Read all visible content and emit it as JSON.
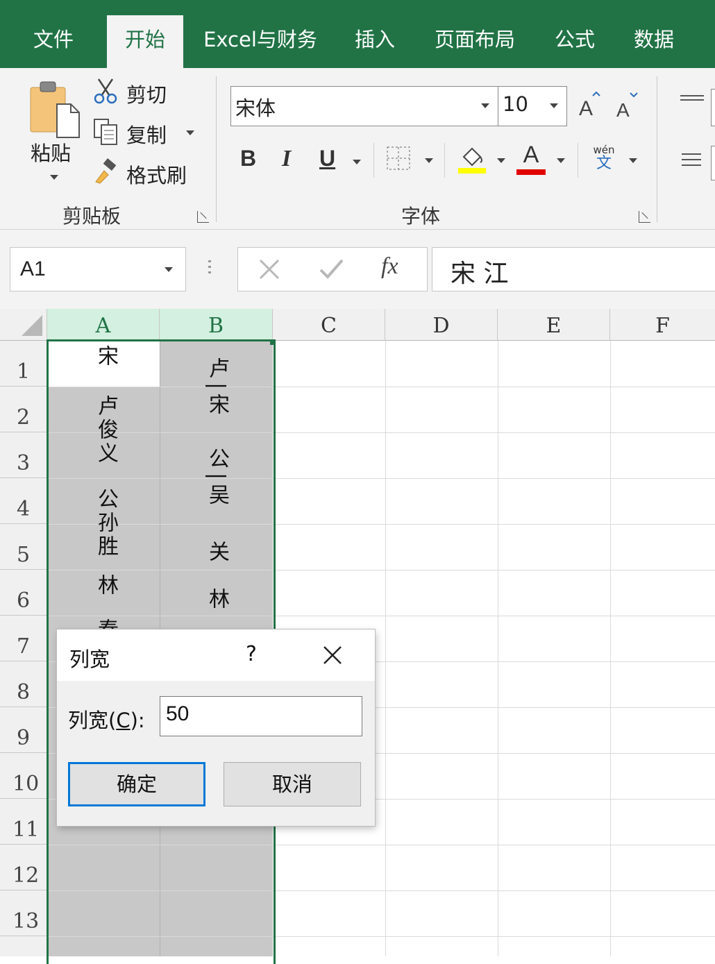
{
  "ribbon": {
    "tabs": [
      {
        "label": "文件",
        "active": false
      },
      {
        "label": "开始",
        "active": true
      },
      {
        "label": "Excel与财务",
        "active": false
      },
      {
        "label": "插入",
        "active": false
      },
      {
        "label": "页面布局",
        "active": false
      },
      {
        "label": "公式",
        "active": false
      },
      {
        "label": "数据",
        "active": false
      }
    ],
    "clipboard": {
      "paste_label": "粘贴",
      "cut_label": "剪切",
      "copy_label": "复制",
      "format_painter_label": "格式刷",
      "group_label": "剪贴板"
    },
    "font": {
      "font_name": "宋体",
      "font_size": "10",
      "bold_label": "B",
      "italic_label": "I",
      "underline_label": "U",
      "font_color_glyph": "A",
      "phonetic_top": "wén",
      "phonetic_bottom": "文",
      "group_label": "字体",
      "fill_color": "#ffff00",
      "font_color": "#e00000"
    }
  },
  "formula_bar": {
    "name_box": "A1",
    "fx_label": "fx",
    "content": "宋 江"
  },
  "sheet": {
    "columns": [
      "A",
      "B",
      "C",
      "D",
      "E",
      "F"
    ],
    "selected_columns": [
      "A",
      "B"
    ],
    "rows": [
      "1",
      "2",
      "3",
      "4",
      "5",
      "6",
      "7",
      "8",
      "9",
      "10",
      "11",
      "12",
      "13"
    ],
    "active_cell": "A1",
    "col_a_texts": [
      "宋",
      "卢俊义",
      "公孙胜",
      "林",
      "秦"
    ],
    "col_b_texts": [
      "卢|宋",
      "公|吴",
      "关",
      "林"
    ],
    "accent": "#217346"
  },
  "dialog": {
    "title": "列宽",
    "help_label": "?",
    "field_label_prefix": "列宽(",
    "field_label_key": "C",
    "field_label_suffix": "):",
    "value": "50",
    "ok_label": "确定",
    "cancel_label": "取消"
  }
}
